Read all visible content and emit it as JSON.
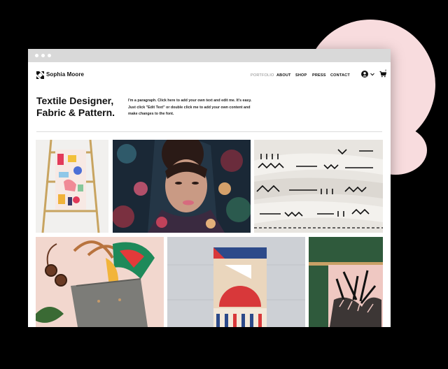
{
  "site": {
    "brand": "Sophia Moore",
    "nav": [
      {
        "label": "PORTFOLIO",
        "active": true
      },
      {
        "label": "ABOUT",
        "active": false
      },
      {
        "label": "SHOP",
        "active": false
      },
      {
        "label": "PRESS",
        "active": false
      },
      {
        "label": "CONTACT",
        "active": false
      }
    ],
    "cart_count": "0",
    "icons": {
      "logo": "logo-mark-icon",
      "account": "user-avatar-icon",
      "account_menu": "chevron-down-icon",
      "cart": "cart-icon"
    }
  },
  "hero": {
    "headline_line1": "Textile Designer,",
    "headline_line2": "Fabric & Pattern.",
    "intro": "I'm a paragraph. Click here to add your own text and edit me. It's easy. Just click \"Edit Text\" or double click me to add your own content and make changes to the font."
  },
  "gallery": [
    "ladder-towels-image",
    "woman-floral-scarf-image",
    "mudcloth-fabric-image",
    "tote-scarf-sunglasses-image",
    "geometric-towel-image",
    "palm-print-fabric-image"
  ],
  "colors": {
    "page_background": "#000000",
    "accent_blob": "#f8dcde",
    "window_chrome": "#d9d9d9",
    "text": "#111111",
    "muted_nav": "#8a8a8a"
  }
}
